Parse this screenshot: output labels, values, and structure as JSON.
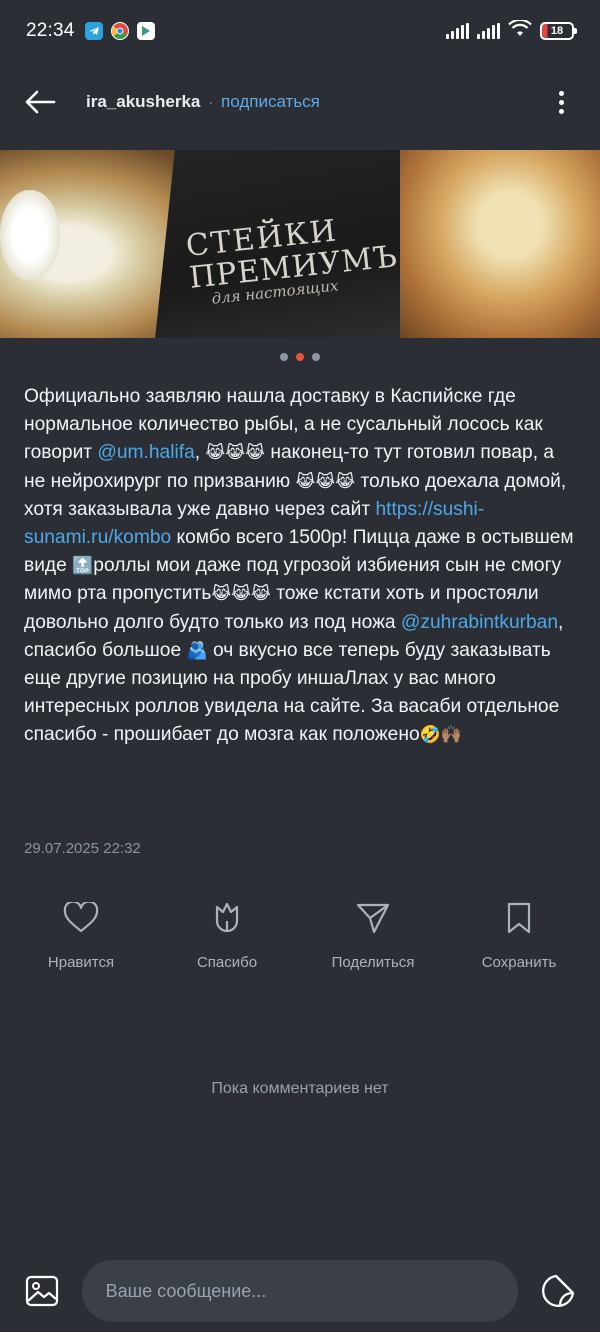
{
  "status_bar": {
    "time": "22:34",
    "battery": "18",
    "app_icons": [
      "telegram-icon",
      "chrome-icon",
      "play-store-icon"
    ]
  },
  "header": {
    "author": "ira_akusherka",
    "separator": "·",
    "subscribe_label": "подписаться"
  },
  "photo": {
    "box_line1": "СТЕЙКИ",
    "box_line2": "ПРЕМИУМЪ",
    "box_line3": "для настоящих",
    "slides_total": 3,
    "active_slide": 2
  },
  "post": {
    "p1": "Официально заявляю нашла доставку в Каспийске где нормальное количество рыбы, а не сусальный лосось как говорит ",
    "mention1": "@um.halifa",
    "p2": ", ",
    "emo1": "😹😹😹",
    "p3": " наконец-то тут готовил повар, а не нейрохирург по призванию ",
    "emo2": "😹😹😹",
    "p4": " только доехала домой, хотя заказывала уже давно через сайт ",
    "link1": "https://sushi-sunami.ru/kombo",
    "p5": " комбо всего 1500р! Пицца даже в остывшем виде ",
    "emo3": "🔝",
    "p6": "роллы мои даже под угрозой избиения сын не смогу мимо рта пропустить",
    "emo4": "😹😹😹",
    "p7": " тоже кстати хоть и простояли довольно долго будто только из под ножа ",
    "mention2": "@zuhrabintkurban",
    "p8": ", спасибо большое ",
    "emo5": "🫂",
    "p9": " оч вкусно все теперь буду заказывать еще другие позицию на пробу иншаЛлах у вас много интересных роллов увидела на сайте. За васаби отдельное спасибо - прошибает до мозга как положено",
    "emo6": "🤣🙌🏽",
    "date": "29.07.2025 22:32"
  },
  "actions": {
    "like": "Нравится",
    "thanks": "Спасибо",
    "share": "Поделиться",
    "save": "Сохранить"
  },
  "comments": {
    "empty_text": "Пока комментариев нет"
  },
  "composer": {
    "placeholder": "Ваше сообщение..."
  },
  "colors": {
    "background": "#2b2f35",
    "link": "#4ea7e6",
    "subscribe": "#5ea8e8",
    "active_dot": "#e8523a"
  }
}
